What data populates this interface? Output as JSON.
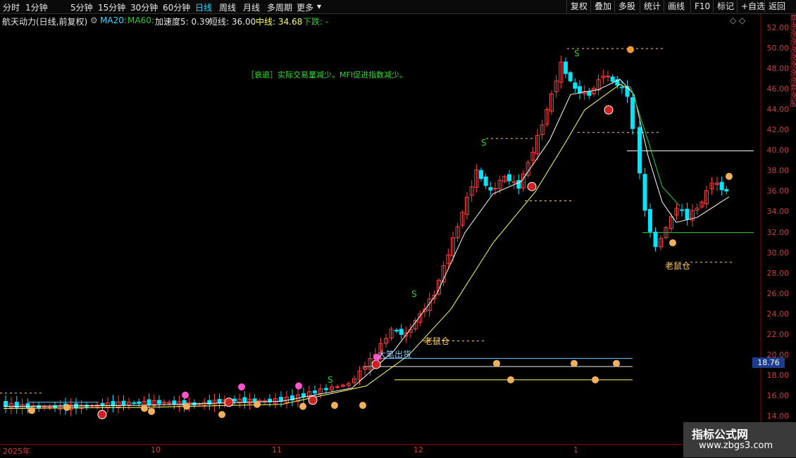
{
  "toolbar": {
    "left_tabs": [
      "分时",
      "1分钟",
      "5分钟",
      "15分钟",
      "30分钟",
      "60分钟",
      "日线",
      "周线",
      "月线",
      "多周期",
      "更多"
    ],
    "active_tab": "日线",
    "right_buttons": [
      "复权",
      "叠加",
      "多股",
      "统计",
      "画线",
      "F10",
      "标记",
      "+自选",
      "返回"
    ]
  },
  "info": {
    "stock_title": "航天动力(日线,前复权)",
    "ma20_label": "MA20:",
    "ma60_label": "MA60:",
    "accel_label": "加速度5: 0.39",
    "short_label": "短线: 36.00",
    "mid_label": "中线: 34.68",
    "down_label": "下跌: -",
    "corner_icons": "◇ ◇"
  },
  "colors": {
    "up": "#ff4040",
    "down": "#00e5ff",
    "ma_white": "#ffffff",
    "ma_yellow": "#ffff66",
    "ma_green": "#33cc33",
    "axis": "#c94040"
  },
  "annotations": {
    "decline_note": "［衰退］实际交易量减少。MFI促进指数减少。",
    "mouse1": "老鼠仓",
    "mouse2": "老鼠仓",
    "big_sell": "大笔出货",
    "s_marks": [
      "S",
      "S",
      "S",
      "S"
    ]
  },
  "y_axis": {
    "labels": [
      "52.00",
      "50.00",
      "48.00",
      "46.00",
      "44.00",
      "42.00",
      "40.00",
      "38.00",
      "36.00",
      "34.00",
      "32.00",
      "30.00",
      "28.00",
      "26.00",
      "24.00",
      "22.00",
      "20.00",
      "18.00",
      "16.00",
      "14.00"
    ],
    "current_price": "18.76"
  },
  "x_axis": {
    "labels": [
      "2025年",
      "10",
      "11",
      "12",
      "1"
    ]
  },
  "watermark": {
    "line1": "指标公式网",
    "line2": "www.zbgs3.com"
  },
  "right_edge_text": "票涨涨涨涨涨涨涨涨票涨股"
}
